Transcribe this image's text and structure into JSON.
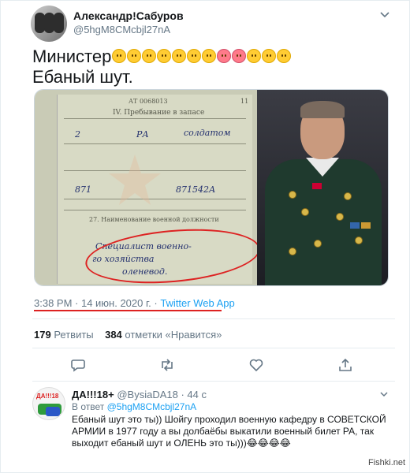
{
  "tweet": {
    "author_name": "Александр!Сабуров",
    "author_handle": "@5hgM8CMcbjl27nA",
    "text_line1": "Министер",
    "text_line2": "Ебаный шут.",
    "emojis": [
      "grinning-face",
      "grinning-squinting-face",
      "tears-of-joy-face",
      "beaming-face",
      "grinning-squinting-face",
      "sweat-smile-face",
      "kissing-face",
      "kissing-heart-face",
      "kissing-heart-face",
      "kissing-face",
      "smiling-face",
      "savoring-food-face"
    ],
    "timestamp": "3:38 PM · 14 июн. 2020 г. · ",
    "app_link": "Twitter Web App",
    "retweets_count": "179",
    "retweets_label": " Ретвиты",
    "likes_count": "384",
    "likes_label": " отметки «Нравится»"
  },
  "media": {
    "doc_number": "АТ 0068013",
    "doc_page": "11",
    "doc_section": "IV. Пребывание в запасе",
    "doc_col1": "2",
    "doc_col2": "РА",
    "doc_col3": "солдатом",
    "doc_code1": "871",
    "doc_code2": "871542А",
    "doc_field": "27. Наименование военной должности",
    "doc_hand1": "Специалист военно-",
    "doc_hand2": "го хозяйства",
    "doc_hand3": "оленевод."
  },
  "actions": [
    "reply-icon",
    "retweet-icon",
    "like-icon",
    "share-icon"
  ],
  "reply": {
    "avatar_text": "ДА!!!18",
    "name": "ДА!!!18+",
    "handle": "@BysiaDA18",
    "dot": " · ",
    "time": "44 с",
    "in_reply_prefix": "В ответ ",
    "in_reply_handle": "@5hgM8CMcbjl27nA",
    "text": "Ебаный шут это ты)) Шойгу проходил военную кафедру в СОВЕТСКОЙ АРМИИ  в 1977 году а вы долбаёбы выкатили военный билет РА, так выходит ебаный шут и ОЛЕНЬ это ты)))😂😂😂😂"
  },
  "watermark": "Fishki.net",
  "colors": {
    "link": "#1da1f2",
    "annotation": "#dd2222",
    "muted": "#657786"
  }
}
